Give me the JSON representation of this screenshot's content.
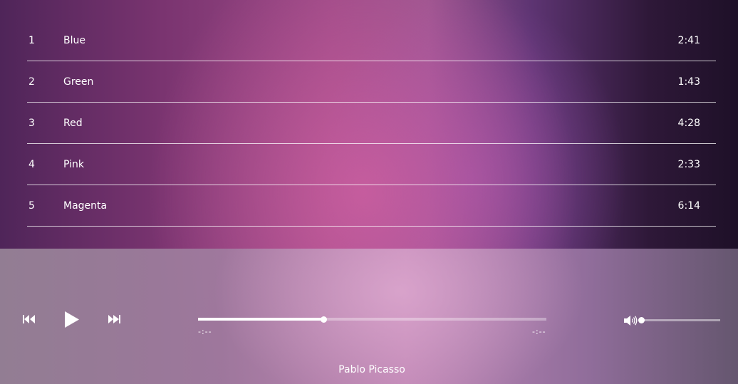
{
  "playlist": {
    "tracks": [
      {
        "number": "1",
        "title": "Blue",
        "duration": "2:41"
      },
      {
        "number": "2",
        "title": "Green",
        "duration": "1:43"
      },
      {
        "number": "3",
        "title": "Red",
        "duration": "4:28"
      },
      {
        "number": "4",
        "title": "Pink",
        "duration": "2:33"
      },
      {
        "number": "5",
        "title": "Magenta",
        "duration": "6:14"
      }
    ]
  },
  "player": {
    "controls": {
      "previous_icon": "skip-previous-icon",
      "play_icon": "play-icon",
      "next_icon": "skip-next-icon",
      "volume_icon": "volume-icon"
    },
    "current_time": "-:--",
    "total_time": "-:--",
    "progress_percent": 36,
    "volume_percent": 2,
    "artist": "Pablo Picasso"
  },
  "colors": {
    "text": "#ffffff",
    "accent": "#b35a97"
  }
}
